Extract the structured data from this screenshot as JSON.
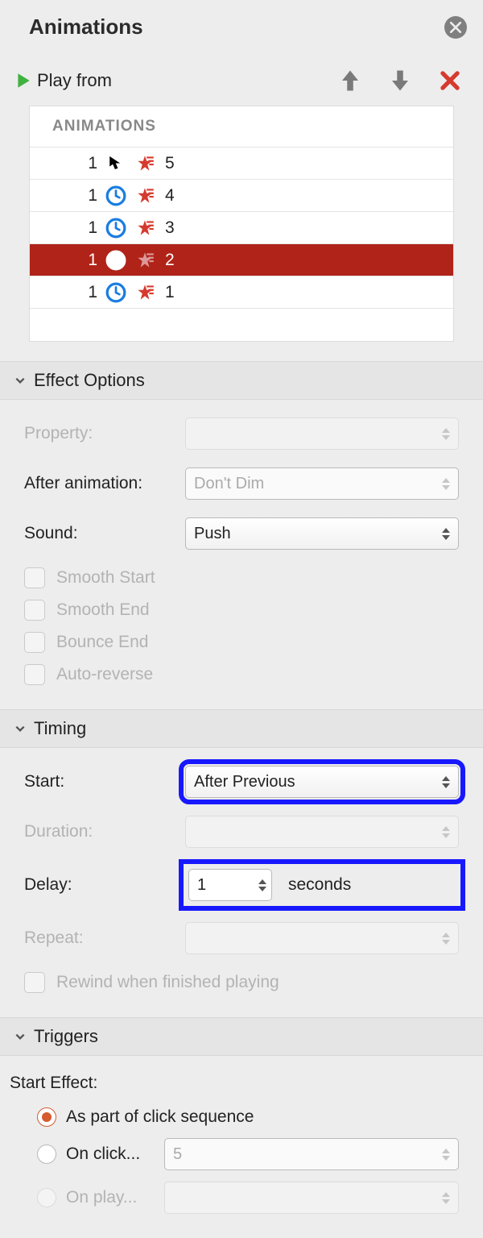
{
  "header": {
    "title": "Animations"
  },
  "play": {
    "label": "Play from"
  },
  "animations": {
    "header": "ANIMATIONS",
    "rows": [
      {
        "seq": "1",
        "trigger": "click",
        "target": "5",
        "selected": false
      },
      {
        "seq": "1",
        "trigger": "clock",
        "target": "4",
        "selected": false
      },
      {
        "seq": "1",
        "trigger": "clock",
        "target": "3",
        "selected": false
      },
      {
        "seq": "1",
        "trigger": "clock",
        "target": "2",
        "selected": true
      },
      {
        "seq": "1",
        "trigger": "clock",
        "target": "1",
        "selected": false
      }
    ]
  },
  "effectOptions": {
    "title": "Effect Options",
    "property_label": "Property:",
    "after_label": "After animation:",
    "after_value": "Don't Dim",
    "sound_label": "Sound:",
    "sound_value": "Push",
    "smooth_start": "Smooth Start",
    "smooth_end": "Smooth End",
    "bounce_end": "Bounce End",
    "auto_reverse": "Auto-reverse"
  },
  "timing": {
    "title": "Timing",
    "start_label": "Start:",
    "start_value": "After Previous",
    "duration_label": "Duration:",
    "delay_label": "Delay:",
    "delay_value": "1",
    "delay_suffix": "seconds",
    "repeat_label": "Repeat:",
    "rewind": "Rewind when finished playing"
  },
  "triggers": {
    "title": "Triggers",
    "start_effect": "Start Effect:",
    "opt1": "As part of click sequence",
    "opt2": "On click...",
    "opt2_value": "5",
    "opt3": "On play..."
  }
}
